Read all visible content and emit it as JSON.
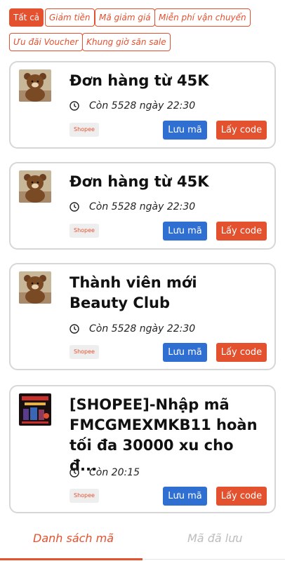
{
  "filters": [
    {
      "label": "Tất cả",
      "active": true
    },
    {
      "label": "Giảm tiền",
      "active": false
    },
    {
      "label": "Mã giảm giá",
      "active": false
    },
    {
      "label": "Miễn phí vận chuyển",
      "active": false
    },
    {
      "label": "Ưu đãi Voucher",
      "active": false
    },
    {
      "label": "Khung giờ săn sale",
      "active": false
    }
  ],
  "vouchers": [
    {
      "title": "Đơn hàng từ 45K",
      "time": "Còn 5528 ngày 22:30",
      "shop": "Shopee",
      "save_label": "Lưu mã",
      "get_label": "Lấy code",
      "thumb": "bear-icon"
    },
    {
      "title": "Đơn hàng từ 45K",
      "time": "Còn 5528 ngày 22:30",
      "shop": "Shopee",
      "save_label": "Lưu mã",
      "get_label": "Lấy code",
      "thumb": "bear-icon"
    },
    {
      "title": "Thành viên mới Beauty Club",
      "time": "Còn 5528 ngày 22:30",
      "shop": "Shopee",
      "save_label": "Lưu mã",
      "get_label": "Lấy code",
      "thumb": "bear-icon"
    },
    {
      "title": "[SHOPEE]-Nhập mã FMCGMEXMKB11 hoàn tối đa 30000 xu cho đ...",
      "time": "Còn 20:15",
      "shop": "Shopee",
      "save_label": "Lưu mã",
      "get_label": "Lấy code",
      "thumb": "promo-banner-icon"
    }
  ],
  "tabs": {
    "list": "Danh sách mã",
    "saved": "Mã đã lưu"
  },
  "colors": {
    "accent": "#e4512f",
    "save": "#2f6fd1"
  }
}
